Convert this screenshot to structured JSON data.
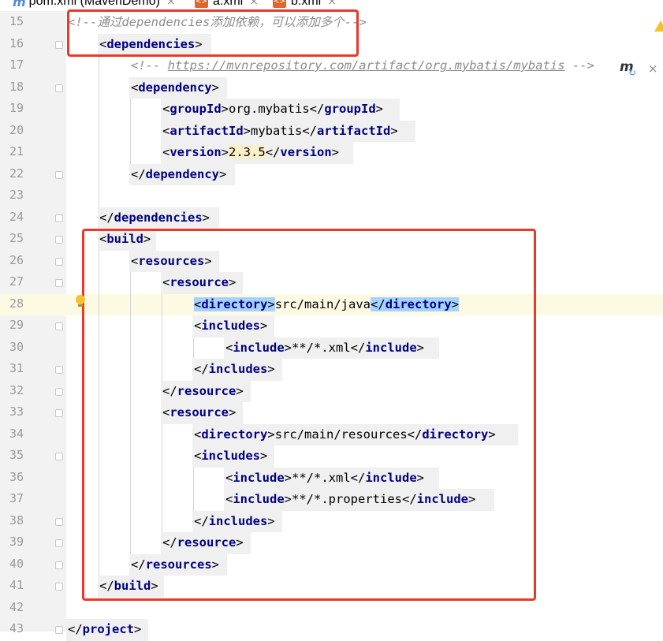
{
  "tabs": [
    {
      "label": "pom.xml (MavenDemo)",
      "icon": "maven-file-icon"
    },
    {
      "label": "a.xml",
      "icon": "xml-file-icon"
    },
    {
      "label": "b.xml",
      "icon": "xml-file-icon"
    }
  ],
  "icons": {
    "xml_badge": "<>",
    "close_glyph": "×",
    "maven_glyph": "m",
    "refresh_glyph": "↻"
  },
  "colors": {
    "tag": "#000080",
    "comment": "#8c8c8c",
    "highlight": "#a6d2ff",
    "annotation_box": "#e8392b"
  },
  "editor": {
    "caret_line": 28,
    "lines": [
      {
        "n": "15",
        "indent": 0,
        "tokens": [
          {
            "t": "comment",
            "v": "<!--通过dependencies添加依赖，可以添加多个-->"
          }
        ]
      },
      {
        "n": "16",
        "indent": 1,
        "fold": true,
        "tokens": [
          {
            "t": "br",
            "v": "<"
          },
          {
            "t": "tag",
            "v": "dependencies"
          },
          {
            "t": "br",
            "v": ">"
          }
        ]
      },
      {
        "n": "17",
        "indent": 2,
        "tokens": [
          {
            "t": "comment",
            "v": "<!-- "
          },
          {
            "t": "url",
            "v": "https://mvnrepository.com/artifact/org.mybatis/mybatis"
          },
          {
            "t": "comment",
            "v": " -->"
          }
        ]
      },
      {
        "n": "18",
        "indent": 2,
        "fold": true,
        "tokens": [
          {
            "t": "br",
            "v": "<"
          },
          {
            "t": "tag",
            "v": "dependency"
          },
          {
            "t": "br",
            "v": ">"
          }
        ]
      },
      {
        "n": "19",
        "indent": 3,
        "tokens": [
          {
            "t": "br",
            "v": "<"
          },
          {
            "t": "tag",
            "v": "groupId"
          },
          {
            "t": "br",
            "v": ">"
          },
          {
            "t": "txt",
            "v": "org.mybatis"
          },
          {
            "t": "br",
            "v": "</"
          },
          {
            "t": "tag",
            "v": "groupId"
          },
          {
            "t": "br",
            "v": ">"
          }
        ]
      },
      {
        "n": "20",
        "indent": 3,
        "tokens": [
          {
            "t": "br",
            "v": "<"
          },
          {
            "t": "tag",
            "v": "artifactId"
          },
          {
            "t": "br",
            "v": ">"
          },
          {
            "t": "txt",
            "v": "mybatis"
          },
          {
            "t": "br",
            "v": "</"
          },
          {
            "t": "tag",
            "v": "artifactId"
          },
          {
            "t": "br",
            "v": ">"
          }
        ]
      },
      {
        "n": "21",
        "indent": 3,
        "tokens": [
          {
            "t": "br",
            "v": "<"
          },
          {
            "t": "tag",
            "v": "version"
          },
          {
            "t": "br",
            "v": ">"
          },
          {
            "t": "ver",
            "v": "2.3.5"
          },
          {
            "t": "br",
            "v": "</"
          },
          {
            "t": "tag",
            "v": "version"
          },
          {
            "t": "br",
            "v": ">"
          }
        ]
      },
      {
        "n": "22",
        "indent": 2,
        "fold": true,
        "tokens": [
          {
            "t": "br",
            "v": "</"
          },
          {
            "t": "tag",
            "v": "dependency"
          },
          {
            "t": "br",
            "v": ">"
          }
        ]
      },
      {
        "n": "23",
        "indent": 0,
        "tokens": []
      },
      {
        "n": "24",
        "indent": 1,
        "fold": true,
        "tokens": [
          {
            "t": "br",
            "v": "</"
          },
          {
            "t": "tag",
            "v": "dependencies"
          },
          {
            "t": "br",
            "v": ">"
          }
        ]
      },
      {
        "n": "25",
        "indent": 1,
        "fold": true,
        "tokens": [
          {
            "t": "br",
            "v": "<"
          },
          {
            "t": "tag",
            "v": "build"
          },
          {
            "t": "br",
            "v": ">"
          }
        ]
      },
      {
        "n": "26",
        "indent": 2,
        "fold": true,
        "tokens": [
          {
            "t": "br",
            "v": "<"
          },
          {
            "t": "tag",
            "v": "resources"
          },
          {
            "t": "br",
            "v": ">"
          }
        ]
      },
      {
        "n": "27",
        "indent": 3,
        "fold": true,
        "tokens": [
          {
            "t": "br",
            "v": "<"
          },
          {
            "t": "tag",
            "v": "resource"
          },
          {
            "t": "br",
            "v": ">"
          }
        ]
      },
      {
        "n": "28",
        "indent": 4,
        "tokens": [
          {
            "t": "hlbr",
            "v": "<"
          },
          {
            "t": "hltag",
            "v": "directory"
          },
          {
            "t": "hlbr",
            "v": ">"
          },
          {
            "t": "txt",
            "v": "src/main/java"
          },
          {
            "t": "hlbr",
            "v": "</"
          },
          {
            "t": "hltag",
            "v": "directory"
          },
          {
            "t": "hlbr",
            "v": ">"
          }
        ]
      },
      {
        "n": "29",
        "indent": 4,
        "fold": true,
        "tokens": [
          {
            "t": "br",
            "v": "<"
          },
          {
            "t": "tag",
            "v": "includes"
          },
          {
            "t": "br",
            "v": ">"
          }
        ]
      },
      {
        "n": "30",
        "indent": 5,
        "tokens": [
          {
            "t": "br",
            "v": "<"
          },
          {
            "t": "tag",
            "v": "include"
          },
          {
            "t": "br",
            "v": ">"
          },
          {
            "t": "txt",
            "v": "**/*.xml"
          },
          {
            "t": "br",
            "v": "</"
          },
          {
            "t": "tag",
            "v": "include"
          },
          {
            "t": "br",
            "v": ">"
          }
        ]
      },
      {
        "n": "31",
        "indent": 4,
        "fold": true,
        "tokens": [
          {
            "t": "br",
            "v": "</"
          },
          {
            "t": "tag",
            "v": "includes"
          },
          {
            "t": "br",
            "v": ">"
          }
        ]
      },
      {
        "n": "32",
        "indent": 3,
        "fold": true,
        "tokens": [
          {
            "t": "br",
            "v": "</"
          },
          {
            "t": "tag",
            "v": "resource"
          },
          {
            "t": "br",
            "v": ">"
          }
        ]
      },
      {
        "n": "33",
        "indent": 3,
        "fold": true,
        "tokens": [
          {
            "t": "br",
            "v": "<"
          },
          {
            "t": "tag",
            "v": "resource"
          },
          {
            "t": "br",
            "v": ">"
          }
        ]
      },
      {
        "n": "34",
        "indent": 4,
        "tokens": [
          {
            "t": "br",
            "v": "<"
          },
          {
            "t": "tag",
            "v": "directory"
          },
          {
            "t": "br",
            "v": ">"
          },
          {
            "t": "txt",
            "v": "src/main/resources"
          },
          {
            "t": "br",
            "v": "</"
          },
          {
            "t": "tag",
            "v": "directory"
          },
          {
            "t": "br",
            "v": ">"
          }
        ]
      },
      {
        "n": "35",
        "indent": 4,
        "fold": true,
        "tokens": [
          {
            "t": "br",
            "v": "<"
          },
          {
            "t": "tag",
            "v": "includes"
          },
          {
            "t": "br",
            "v": ">"
          }
        ]
      },
      {
        "n": "36",
        "indent": 5,
        "tokens": [
          {
            "t": "br",
            "v": "<"
          },
          {
            "t": "tag",
            "v": "include"
          },
          {
            "t": "br",
            "v": ">"
          },
          {
            "t": "txt",
            "v": "**/*.xml"
          },
          {
            "t": "br",
            "v": "</"
          },
          {
            "t": "tag",
            "v": "include"
          },
          {
            "t": "br",
            "v": ">"
          }
        ]
      },
      {
        "n": "37",
        "indent": 5,
        "tokens": [
          {
            "t": "br",
            "v": "<"
          },
          {
            "t": "tag",
            "v": "include"
          },
          {
            "t": "br",
            "v": ">"
          },
          {
            "t": "txt",
            "v": "**/*.properties"
          },
          {
            "t": "br",
            "v": "</"
          },
          {
            "t": "tag",
            "v": "include"
          },
          {
            "t": "br",
            "v": ">"
          }
        ]
      },
      {
        "n": "38",
        "indent": 4,
        "fold": true,
        "tokens": [
          {
            "t": "br",
            "v": "</"
          },
          {
            "t": "tag",
            "v": "includes"
          },
          {
            "t": "br",
            "v": ">"
          }
        ]
      },
      {
        "n": "39",
        "indent": 3,
        "fold": true,
        "tokens": [
          {
            "t": "br",
            "v": "</"
          },
          {
            "t": "tag",
            "v": "resource"
          },
          {
            "t": "br",
            "v": ">"
          }
        ]
      },
      {
        "n": "40",
        "indent": 2,
        "fold": true,
        "tokens": [
          {
            "t": "br",
            "v": "</"
          },
          {
            "t": "tag",
            "v": "resources"
          },
          {
            "t": "br",
            "v": ">"
          }
        ]
      },
      {
        "n": "41",
        "indent": 1,
        "fold": true,
        "tokens": [
          {
            "t": "br",
            "v": "</"
          },
          {
            "t": "tag",
            "v": "build"
          },
          {
            "t": "br",
            "v": ">"
          }
        ]
      },
      {
        "n": "42",
        "indent": 0,
        "tokens": []
      },
      {
        "n": "43",
        "indent": 0,
        "fold": true,
        "tokens": [
          {
            "t": "br",
            "v": "</"
          },
          {
            "t": "tag",
            "v": "project"
          },
          {
            "t": "br",
            "v": ">"
          }
        ]
      }
    ]
  }
}
